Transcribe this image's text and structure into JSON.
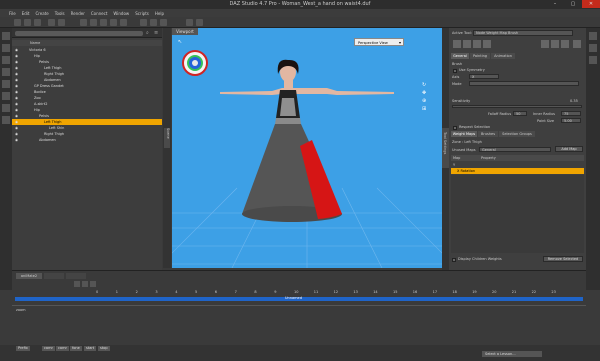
{
  "window": {
    "title": "DAZ Studio 4.7 Pro - Woman_West_a hand on waist4.duf"
  },
  "menu": [
    "File",
    "Edit",
    "Create",
    "Tools",
    "Render",
    "Connect",
    "Window",
    "Scripts",
    "Help"
  ],
  "scene": {
    "title_label": "Name",
    "rows": [
      {
        "label": "Victoria 6",
        "depth": 1
      },
      {
        "label": "Hip",
        "depth": 2
      },
      {
        "label": "Pelvis",
        "depth": 3
      },
      {
        "label": "Left Thigh",
        "depth": 4
      },
      {
        "label": "Right Thigh",
        "depth": 4
      },
      {
        "label": "Abdomen",
        "depth": 4
      },
      {
        "label": "GP Dress Gandet",
        "depth": 2
      },
      {
        "label": "Bodice",
        "depth": 2
      },
      {
        "label": "Zoo",
        "depth": 2
      },
      {
        "label": "A-skirt2",
        "depth": 2
      },
      {
        "label": "Hip",
        "depth": 2
      },
      {
        "label": "Pelvis",
        "depth": 3
      },
      {
        "label": "Left Thigh",
        "depth": 4,
        "selected": true
      },
      {
        "label": "Left Shin",
        "depth": 5
      },
      {
        "label": "Right Thigh",
        "depth": 4
      },
      {
        "label": "Abdomen",
        "depth": 3
      }
    ]
  },
  "viewport": {
    "tab": "Viewport",
    "view": "Perspective View"
  },
  "side_tabs": {
    "left": "Scene",
    "right": "Tool Settings"
  },
  "tool": {
    "active_tool_label": "Active Tool:",
    "active_tool_value": "Node Weight Map Brush",
    "tabs": [
      "General",
      "Painting",
      "Animation"
    ],
    "brush_label": "Brush",
    "use_symmetry": "Use Symmetry",
    "axis_label": "Axis",
    "axis_value": "X",
    "mode_label": "Mode",
    "sensitivity_label": "Sensitivity",
    "sensitivity_value": "0.35",
    "falloff_label": "Falloff Radius",
    "falloff_value": "50",
    "inner_radius_label": "Inner Radius",
    "inner_radius_value": "75",
    "point_size_label": "Point Size",
    "point_size_value": "5.00",
    "respect_selection": "Respect Selection",
    "sub_tabs": [
      "Weight Maps",
      "Brushes",
      "Selection Groups"
    ],
    "zone_label": "Zone : Left Thigh",
    "unused_maps_label": "Unused Maps",
    "unused_maps_value": "General",
    "add_map_button": "Add Map",
    "map_col": "Map",
    "property_col": "Property",
    "map_group": "Y",
    "map_item": "X Rotation",
    "display_children": "Display Children Weights",
    "remove_selected": "Remove Selected"
  },
  "timeline": {
    "tab": "aniMate2",
    "row_label": "Victoria 6",
    "track_label": "Unnamed",
    "sub_label": "zoom",
    "ticks": [
      "0",
      "1",
      "2",
      "3",
      "4",
      "5",
      "6",
      "7",
      "8",
      "9",
      "10",
      "11",
      "12",
      "13",
      "14",
      "15",
      "16",
      "17",
      "18",
      "19",
      "20",
      "21",
      "22",
      "23"
    ]
  },
  "status": {
    "buttons": [
      "Prefix",
      "camr",
      "camr",
      "fone",
      "start",
      "stop"
    ],
    "lesson": "Select a Lesson..."
  }
}
